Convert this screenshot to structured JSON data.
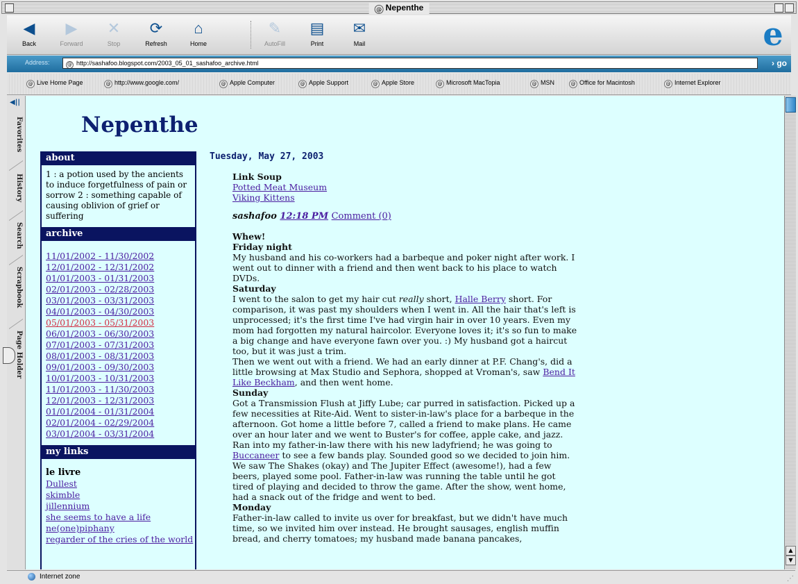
{
  "window": {
    "title": "Nepenthe"
  },
  "toolbar": {
    "buttons": [
      {
        "label": "Back",
        "icon": "back-arrow-icon",
        "enabled": true
      },
      {
        "label": "Forward",
        "icon": "forward-arrow-icon",
        "enabled": false
      },
      {
        "label": "Stop",
        "icon": "stop-icon",
        "enabled": false
      },
      {
        "label": "Refresh",
        "icon": "refresh-icon",
        "enabled": true
      },
      {
        "label": "Home",
        "icon": "home-icon",
        "enabled": true
      },
      {
        "label": "AutoFill",
        "icon": "autofill-icon",
        "enabled": false
      },
      {
        "label": "Print",
        "icon": "print-icon",
        "enabled": true
      },
      {
        "label": "Mail",
        "icon": "mail-icon",
        "enabled": true
      }
    ]
  },
  "address": {
    "label": "Address:",
    "url": "http://sashafoo.blogspot.com/2003_05_01_sashafoo_archive.html",
    "go": "go"
  },
  "favorites": [
    "Live Home Page",
    "http://www.google.com/",
    "Apple Computer",
    "Apple Support",
    "Apple Store",
    "Microsoft MacTopia",
    "MSN",
    "Office for Macintosh",
    "Internet Explorer"
  ],
  "side_tabs": [
    "Favorites",
    "History",
    "Search",
    "Scrapbook",
    "Page Holder"
  ],
  "blog": {
    "title": "Nepenthe",
    "about": {
      "heading": "about",
      "text": "1 : a potion used by the ancients to induce forgetfulness of pain or sorrow 2 : something capable of causing oblivion of grief or suffering"
    },
    "archive": {
      "heading": "archive",
      "items": [
        "11/01/2002 - 11/30/2002",
        "12/01/2002 - 12/31/2002",
        "01/01/2003 - 01/31/2003",
        "02/01/2003 - 02/28/2003",
        "03/01/2003 - 03/31/2003",
        "04/01/2003 - 04/30/2003",
        "05/01/2003 - 05/31/2003",
        "06/01/2003 - 06/30/2003",
        "07/01/2003 - 07/31/2003",
        "08/01/2003 - 08/31/2003",
        "09/01/2003 - 09/30/2003",
        "10/01/2003 - 10/31/2003",
        "11/01/2003 - 11/30/2003",
        "12/01/2003 - 12/31/2003",
        "01/01/2004 - 01/31/2004",
        "02/01/2004 - 02/29/2004",
        "03/01/2004 - 03/31/2004"
      ],
      "current_index": 6
    },
    "mylinks": {
      "heading": "my links",
      "subheading": "le livre",
      "items": [
        "Dullest",
        "skimble",
        "jillennium",
        "she seems to have a life",
        "ne(one)piphany",
        "regarder of the cries of the world"
      ]
    },
    "date": "Tuesday, May 27, 2003",
    "post1": {
      "title": "Link Soup",
      "links": [
        "Potted Meat Museum",
        "Viking Kittens"
      ],
      "author": "sashafoo",
      "time": "12:18 PM",
      "comment": "Comment (0)"
    },
    "post2": {
      "title": "Whew!",
      "fri_heading": "Friday night",
      "fri_text": "My husband and his co-workers had a barbeque and poker night after work. I went out to dinner with a friend and then went back to his place to watch DVDs.",
      "sat_heading": "Saturday",
      "sat_a": "I went to the salon to get my hair cut ",
      "sat_em": "really",
      "sat_b": " short, ",
      "sat_link": "Halle Berry",
      "sat_c": " short. For comparison, it was past my shoulders when I went in. All the hair that's left is unprocessed; it's the first time I've had virgin hair in over 10 years. Even my mom had forgotten my natural haircolor. Everyone loves it; it's so fun to make a big change and have everyone fawn over you. :) My husband got a haircut too, but it was just a trim.",
      "sat_d": "Then we went out with a friend. We had an early dinner at P.F. Chang's, did a little browsing at Max Studio and Sephora, shopped at Vroman's, saw ",
      "sat_link2": "Bend It Like Beckham",
      "sat_e": ", and then went home.",
      "sun_heading": "Sunday",
      "sun_a": "Got a Transmission Flush at Jiffy Lube; car purred in satisfaction. Picked up a few necessities at Rite-Aid. Went to sister-in-law's place for a barbeque in the afternoon. Got home a little before 7, called a friend to make plans. He came over an hour later and we went to Buster's for coffee, apple cake, and jazz. Ran into my father-in-law there with his new ladyfriend; he was going to ",
      "sun_link": "Buccaneer",
      "sun_b": " to see a few bands play. Sounded good so we decided to join him. We saw The Shakes (okay) and The Jupiter Effect (awesome!), had a few beers, played some pool. Father-in-law was running the table until he got tired of playing and decided to throw the game. After the show, went home, had a snack out of the fridge and went to bed.",
      "mon_heading": "Monday",
      "mon_text": "Father-in-law called to invite us over for breakfast, but we didn't have much time, so we invited him over instead. He brought sausages, english muffin bread, and cherry tomatoes; my husband made banana pancakes,"
    }
  },
  "status": {
    "zone": "Internet zone"
  },
  "colors": {
    "page_bg": "#ddffff",
    "nav_heading_bg": "#0a1460",
    "link": "#4a1ca0",
    "visited_current": "#d22c40",
    "address_bar": "#2f7fb2"
  }
}
